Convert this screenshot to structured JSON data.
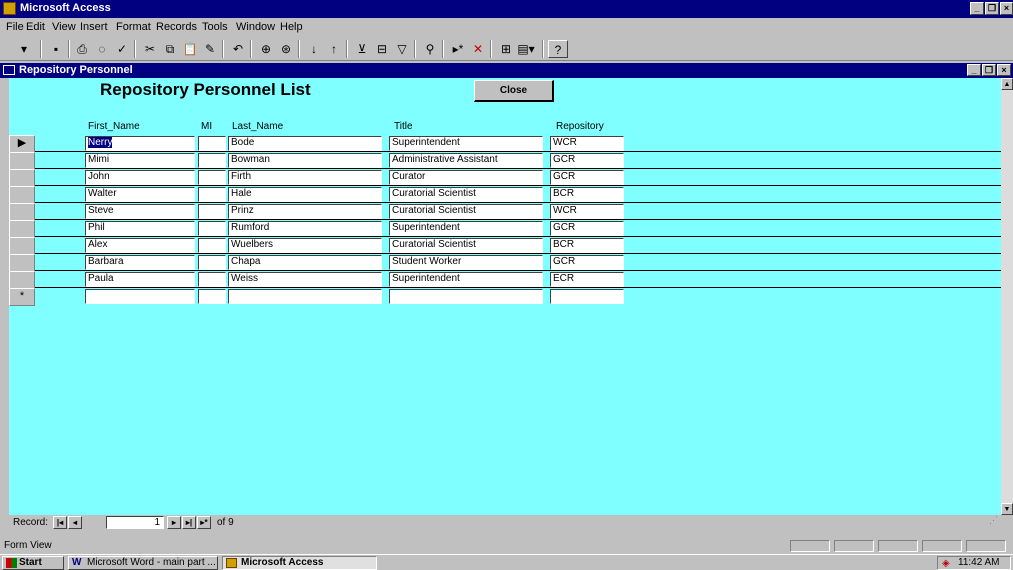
{
  "app": {
    "title": "Microsoft Access"
  },
  "menu": [
    "File",
    "Edit",
    "View",
    "Insert",
    "Format",
    "Records",
    "Tools",
    "Window",
    "Help"
  ],
  "form": {
    "window_title": "Repository Personnel",
    "heading": "Repository Personnel List",
    "close_label": "Close",
    "columns": {
      "first": "First_Name",
      "mi": "MI",
      "last": "Last_Name",
      "title": "Title",
      "repo": "Repository"
    },
    "records": [
      {
        "first": "Nerry",
        "mi": "",
        "last": "Bode",
        "title": "Superintendent",
        "repo": "WCR"
      },
      {
        "first": "Mimi",
        "mi": "",
        "last": "Bowman",
        "title": "Administrative Assistant",
        "repo": "GCR"
      },
      {
        "first": "John",
        "mi": "",
        "last": "Firth",
        "title": "Curator",
        "repo": "GCR"
      },
      {
        "first": "Walter",
        "mi": "",
        "last": "Hale",
        "title": "Curatorial Scientist",
        "repo": "BCR"
      },
      {
        "first": "Steve",
        "mi": "",
        "last": "Prinz",
        "title": "Curatorial Scientist",
        "repo": "WCR"
      },
      {
        "first": "Phil",
        "mi": "",
        "last": "Rumford",
        "title": "Superintendent",
        "repo": "GCR"
      },
      {
        "first": "Alex",
        "mi": "",
        "last": "Wuelbers",
        "title": "Curatorial Scientist",
        "repo": "BCR"
      },
      {
        "first": "Barbara",
        "mi": "",
        "last": "Chapa",
        "title": "Student Worker",
        "repo": "GCR"
      },
      {
        "first": "Paula",
        "mi": "",
        "last": "Weiss",
        "title": "Superintendent",
        "repo": "ECR"
      }
    ]
  },
  "navigation": {
    "label": "Record:",
    "current": "1",
    "of_text": "of 9"
  },
  "status": {
    "text": "Form View"
  },
  "taskbar": {
    "start": "Start",
    "task_word": "Microsoft Word - main part ...",
    "task_access": "Microsoft Access",
    "clock": "11:42 AM"
  },
  "colors": {
    "form_bg": "#7fffff",
    "title_bar": "#000080"
  }
}
